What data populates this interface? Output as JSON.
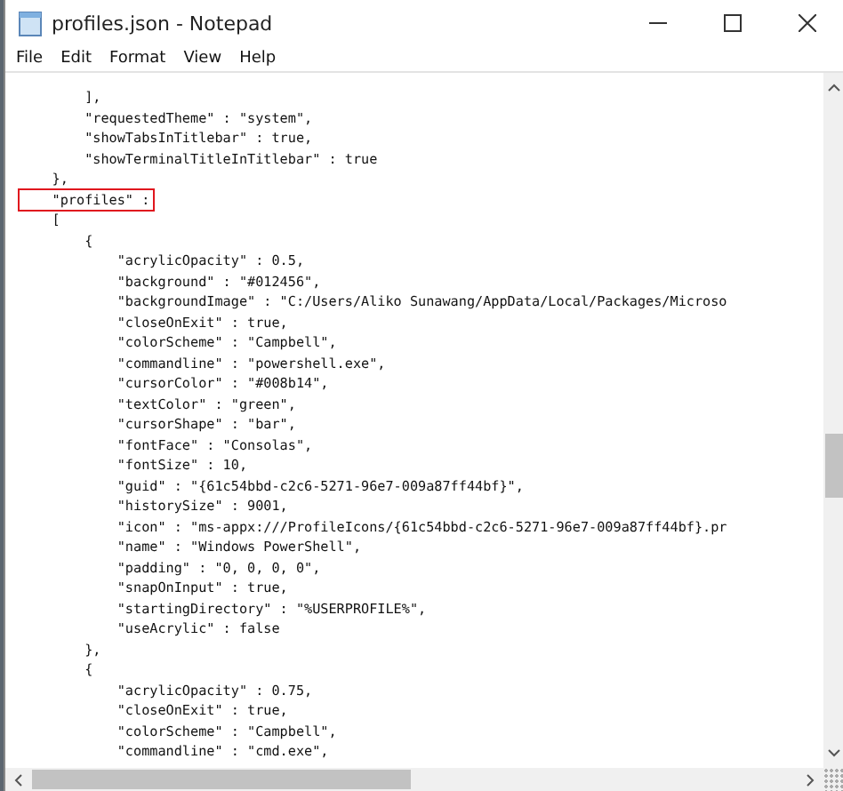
{
  "window": {
    "title": "profiles.json - Notepad"
  },
  "menu": [
    "File",
    "Edit",
    "Format",
    "View",
    "Help"
  ],
  "lines": [
    {
      "text": "        ],",
      "highlighted": false
    },
    {
      "text": "        \"requestedTheme\" : \"system\",",
      "highlighted": false
    },
    {
      "text": "        \"showTabsInTitlebar\" : true,",
      "highlighted": false
    },
    {
      "text": "        \"showTerminalTitleInTitlebar\" : true",
      "highlighted": false
    },
    {
      "text": "    },",
      "highlighted": false
    },
    {
      "text": "    \"profiles\" :",
      "highlighted": true
    },
    {
      "text": "    [",
      "highlighted": false
    },
    {
      "text": "        {",
      "highlighted": false
    },
    {
      "text": "            \"acrylicOpacity\" : 0.5,",
      "highlighted": false
    },
    {
      "text": "            \"background\" : \"#012456\",",
      "highlighted": false
    },
    {
      "text": "            \"backgroundImage\" : \"C:/Users/Aliko Sunawang/AppData/Local/Packages/Microso",
      "highlighted": false
    },
    {
      "text": "            \"closeOnExit\" : true,",
      "highlighted": false
    },
    {
      "text": "            \"colorScheme\" : \"Campbell\",",
      "highlighted": false
    },
    {
      "text": "            \"commandline\" : \"powershell.exe\",",
      "highlighted": false
    },
    {
      "text": "            \"cursorColor\" : \"#008b14\",",
      "highlighted": false
    },
    {
      "text": "            \"textColor\" : \"green\",",
      "highlighted": false
    },
    {
      "text": "            \"cursorShape\" : \"bar\",",
      "highlighted": false
    },
    {
      "text": "            \"fontFace\" : \"Consolas\",",
      "highlighted": false
    },
    {
      "text": "            \"fontSize\" : 10,",
      "highlighted": false
    },
    {
      "text": "            \"guid\" : \"{61c54bbd-c2c6-5271-96e7-009a87ff44bf}\",",
      "highlighted": false
    },
    {
      "text": "            \"historySize\" : 9001,",
      "highlighted": false
    },
    {
      "text": "            \"icon\" : \"ms-appx:///ProfileIcons/{61c54bbd-c2c6-5271-96e7-009a87ff44bf}.pr",
      "highlighted": false
    },
    {
      "text": "            \"name\" : \"Windows PowerShell\",",
      "highlighted": false
    },
    {
      "text": "            \"padding\" : \"0, 0, 0, 0\",",
      "highlighted": false
    },
    {
      "text": "            \"snapOnInput\" : true,",
      "highlighted": false
    },
    {
      "text": "            \"startingDirectory\" : \"%USERPROFILE%\",",
      "highlighted": false
    },
    {
      "text": "            \"useAcrylic\" : false",
      "highlighted": false
    },
    {
      "text": "        },",
      "highlighted": false
    },
    {
      "text": "        {",
      "highlighted": false
    },
    {
      "text": "            \"acrylicOpacity\" : 0.75,",
      "highlighted": false
    },
    {
      "text": "            \"closeOnExit\" : true,",
      "highlighted": false
    },
    {
      "text": "            \"colorScheme\" : \"Campbell\",",
      "highlighted": false
    },
    {
      "text": "            \"commandline\" : \"cmd.exe\",",
      "highlighted": false
    }
  ]
}
